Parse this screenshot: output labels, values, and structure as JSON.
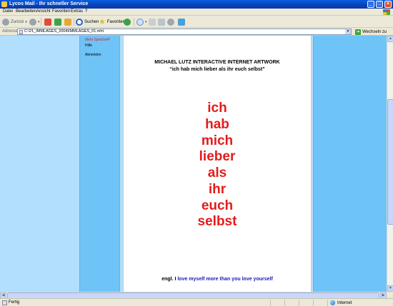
{
  "window": {
    "title": "Lycos Mail - Ihr schneller Service"
  },
  "menu": [
    "Datei",
    "Bearbeiten",
    "Ansicht",
    "Favoriten",
    "Extras",
    "?"
  ],
  "toolbar": {
    "back": "Zurück",
    "search": "Suchen",
    "favorites": "Favoriten"
  },
  "address": {
    "label": "Adresse",
    "value": "C:\\21_IMMLAGES_2004\\IMMLAGES_01.mht",
    "go": "Wechseln zu"
  },
  "sidebar": {
    "items": [
      "Mehr Speicher",
      "Hilfe",
      "Abmelden"
    ]
  },
  "content": {
    "title": "MICHAEL LUTZ INTERACTIVE INTERNET ARTWORK",
    "subtitle": "“ich hab mich lieber als ihr euch selbst”",
    "poem": [
      "ich",
      "hab",
      "mich",
      "lieber",
      "als",
      "ihr",
      "euch",
      "selbst"
    ],
    "footer_prefix": "engl. I ",
    "footer_highlight": "love myself more than you love yourself"
  },
  "status": {
    "text": "Fertig",
    "zone": "Internet"
  },
  "colors": {
    "poem": "#e41b1b",
    "page_bg": "#b1dffd",
    "nav_bg": "#6ec3f7",
    "footer_link": "#1a1ab8"
  }
}
